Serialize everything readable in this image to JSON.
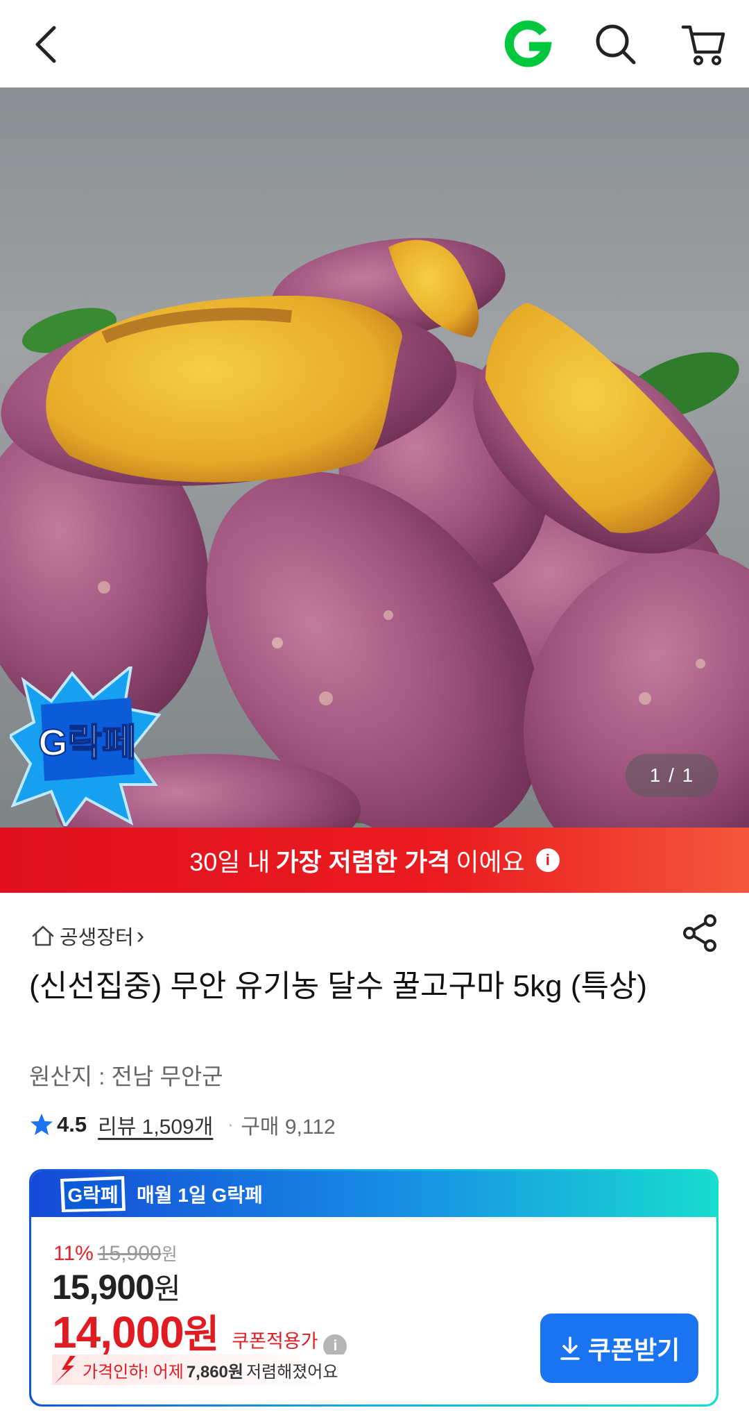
{
  "header": {
    "back_icon": "chevron-left-icon",
    "logo": "G",
    "search_icon": "search-icon",
    "cart_icon": "cart-icon",
    "brand_color": "#00c73c"
  },
  "hero": {
    "image_alt": "",
    "counter": "1 / 1",
    "badge_text": "G락페"
  },
  "lowest_banner": {
    "prefix": "30일 내",
    "bold": "가장 저렴한 가격",
    "suffix": "이에요",
    "info": "i",
    "colors": [
      "#e0101f",
      "#f4573d"
    ]
  },
  "product": {
    "store": "공생장터",
    "store_chevron": "›",
    "title": "(신선집중) 무안 유기농 달수 꿀고구마 5kg (특상)",
    "origin": "원산지 : 전남 무안군",
    "rating": "4.5",
    "reviews": "리뷰 1,509개",
    "separator": "·",
    "purchases": "구매 9,112"
  },
  "price_card": {
    "badge": "G락페",
    "title": "매월 1일 G락페",
    "discount_rate": "11%",
    "original_price": "15,900",
    "original_unit": "원",
    "sale_price": "15,900",
    "sale_unit": "원",
    "coupon_price": "14,000",
    "coupon_unit": "원",
    "coupon_label": "쿠폰적용가",
    "coupon_info": "i",
    "drop_note_lead": "가격인하! 어제",
    "drop_amount": "7,860원",
    "drop_note_tail": "저렴해졌어요",
    "coupon_button": "쿠폰받기",
    "accent": "#1a73f0",
    "price_red": "#e01b22"
  }
}
